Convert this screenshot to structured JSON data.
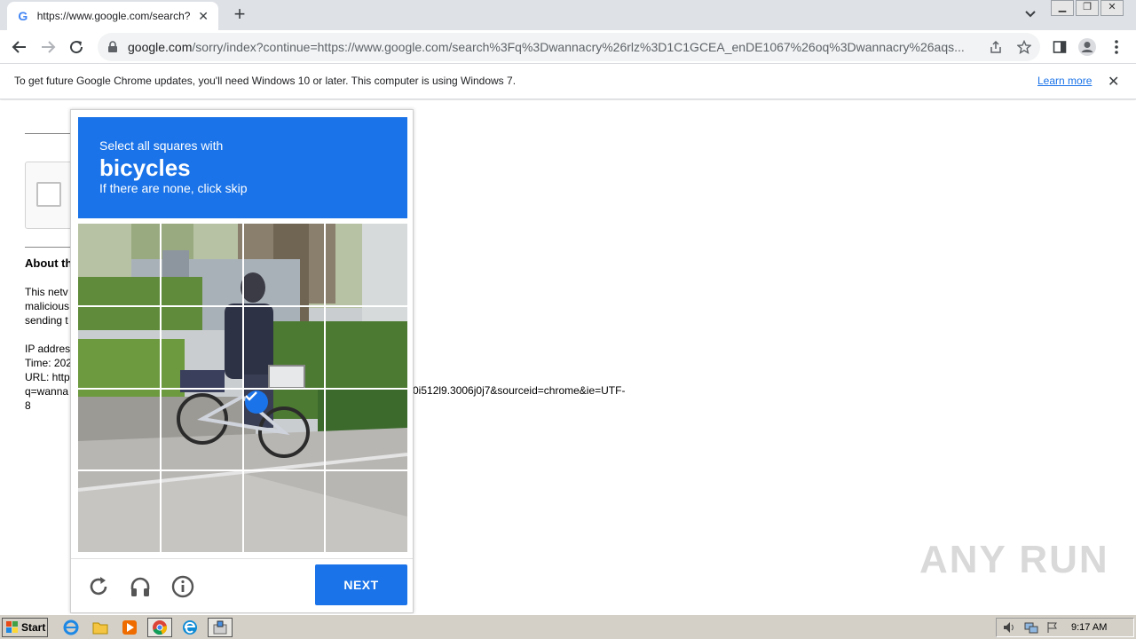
{
  "browser": {
    "tab_title": "https://www.google.com/search?q=",
    "favicon_letter": "G",
    "url_host": "google.com",
    "url_rest": "/sorry/index?continue=https://www.google.com/search%3Fq%3Dwannacry%26rlz%3D1C1GCEA_enDE1067%26oq%3Dwannacry%26aqs...",
    "infobar_message": "To get future Google Chrome updates, you'll need Windows 10 or later. This computer is using Windows 7.",
    "infobar_link": "Learn more"
  },
  "page": {
    "about_heading": "About th",
    "lines_a": [
      "This netv",
      "malicious",
      "sending t"
    ],
    "lines_b": [
      "IP addres",
      "Time: 202",
      "URL: http",
      "q=wanna",
      "8"
    ],
    "url_tail": "0i512l9.3006j0j7&sourceid=chrome&ie=UTF-"
  },
  "captcha": {
    "prompt_line1": "Select all squares with",
    "target_word": "bicycles",
    "prompt_line3": "If there are none, click skip",
    "next_label": "NEXT",
    "selected_tiles": [
      10
    ],
    "accent_color": "#1a73e8"
  },
  "watermark": "ANY RUN",
  "taskbar": {
    "start_label": "Start",
    "clock": "9:17 AM"
  }
}
